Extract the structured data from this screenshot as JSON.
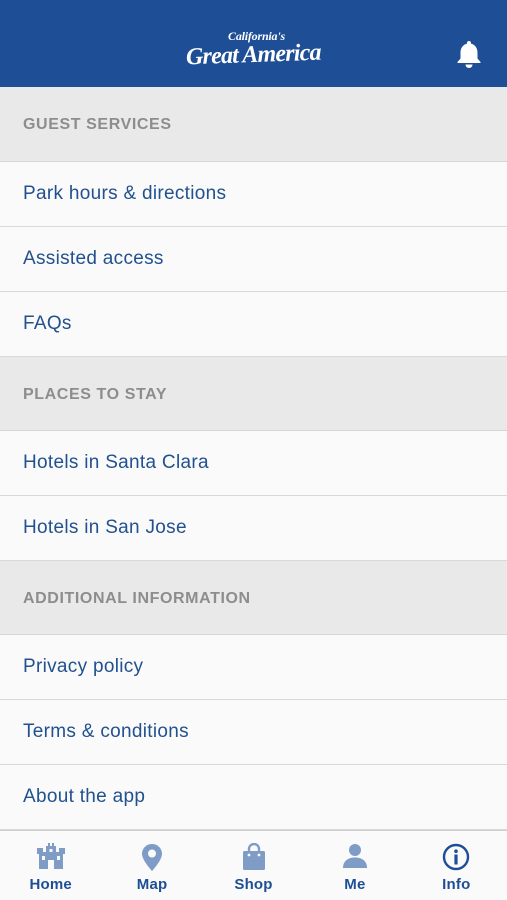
{
  "header": {
    "logo_top": "California's",
    "logo_main": "Great America",
    "bell_icon": "bell-icon",
    "color": "#1e4e95"
  },
  "sections": [
    {
      "title": "GUEST SERVICES",
      "items": [
        "Park hours & directions",
        "Assisted access",
        "FAQs"
      ]
    },
    {
      "title": "PLACES TO STAY",
      "items": [
        "Hotels in Santa Clara",
        "Hotels in San Jose"
      ]
    },
    {
      "title": "ADDITIONAL INFORMATION",
      "items": [
        "Privacy policy",
        "Terms & conditions",
        "About the app"
      ]
    }
  ],
  "tabbar": {
    "tabs": [
      {
        "label": "Home",
        "icon": "castle-icon",
        "active": false
      },
      {
        "label": "Map",
        "icon": "map-pin-icon",
        "active": false
      },
      {
        "label": "Shop",
        "icon": "shopping-bag-icon",
        "active": false
      },
      {
        "label": "Me",
        "icon": "person-icon",
        "active": false
      },
      {
        "label": "Info",
        "icon": "info-icon",
        "active": true
      }
    ],
    "active_color": "#1e4e95",
    "inactive_icon_color": "#7f9cc7"
  }
}
